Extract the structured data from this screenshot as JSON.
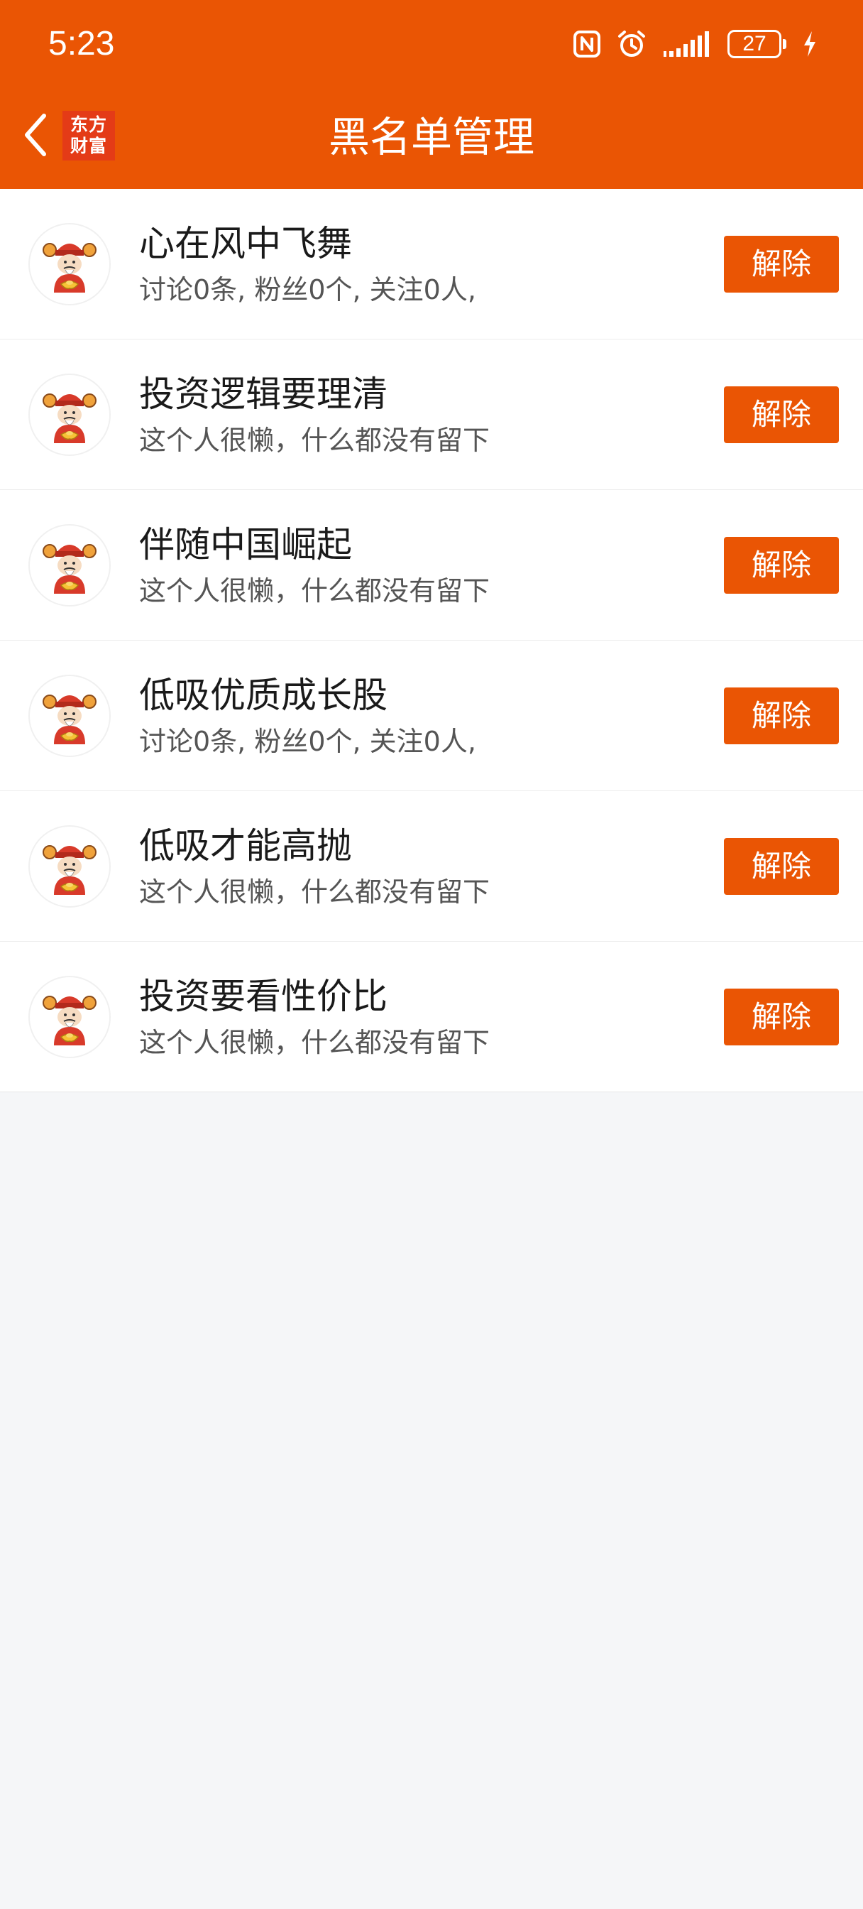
{
  "status_bar": {
    "time": "5:23",
    "battery_level": "27",
    "icons": [
      "nfc-icon",
      "alarm-icon",
      "signal-icon",
      "battery-icon",
      "charging-icon"
    ]
  },
  "nav": {
    "title": "黑名单管理",
    "logo_line1": "东方",
    "logo_line2": "财富",
    "back_icon": "chevron-left-icon"
  },
  "colors": {
    "brand": "#ea5504",
    "background": "#f5f6f8"
  },
  "blacklist": [
    {
      "name": "心在风中飞舞",
      "desc": "讨论0条, 粉丝0个, 关注0人,",
      "button": "解除"
    },
    {
      "name": "投资逻辑要理清",
      "desc": "这个人很懒，什么都没有留下",
      "button": "解除"
    },
    {
      "name": "伴随中国崛起",
      "desc": "这个人很懒，什么都没有留下",
      "button": "解除"
    },
    {
      "name": "低吸优质成长股",
      "desc": "讨论0条, 粉丝0个, 关注0人,",
      "button": "解除"
    },
    {
      "name": "低吸才能高抛",
      "desc": "这个人很懒，什么都没有留下",
      "button": "解除"
    },
    {
      "name": "投资要看性价比",
      "desc": "这个人很懒，什么都没有留下",
      "button": "解除"
    }
  ]
}
